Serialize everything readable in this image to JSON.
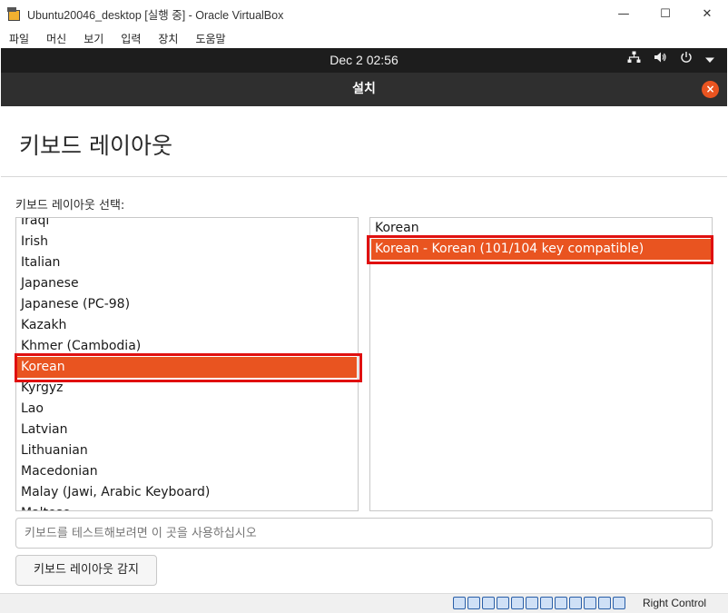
{
  "window": {
    "title": "Ubuntu20046_desktop [실행 중] - Oracle VirtualBox",
    "minimize_glyph": "—",
    "maximize_glyph": "☐",
    "close_glyph": "✕"
  },
  "menu": [
    "파일",
    "머신",
    "보기",
    "입력",
    "장치",
    "도움말"
  ],
  "panel": {
    "clock": "Dec 2  02:56",
    "icons": [
      "network-icon",
      "volume-icon",
      "power-icon",
      "chevron-down-icon"
    ]
  },
  "installer": {
    "header_title": "설치",
    "close_glyph": "×",
    "page_title": "키보드 레이아웃",
    "layout_label": "키보드 레이아웃 선택:",
    "layouts": [
      "Iraqi",
      "Irish",
      "Italian",
      "Japanese",
      "Japanese (PC-98)",
      "Kazakh",
      "Khmer (Cambodia)",
      "Korean",
      "Kyrgyz",
      "Lao",
      "Latvian",
      "Lithuanian",
      "Macedonian",
      "Malay (Jawi, Arabic Keyboard)",
      "Maltese"
    ],
    "selected_layout": "Korean",
    "variants": [
      "Korean",
      "Korean - Korean (101/104 key compatible)"
    ],
    "selected_variant": "Korean - Korean (101/104 key compatible)",
    "test_placeholder": "키보드를 테스트해보려면 이 곳을 사용하십시오",
    "detect_button": "키보드 레이아웃 감지"
  },
  "statusbar": {
    "host_key": "Right Control",
    "icons": [
      "hdd-icon",
      "optical-icon",
      "audio-icon",
      "network-icon",
      "usb-icon",
      "shared-folder-icon",
      "display-icon",
      "video-capture-icon",
      "cpu-icon",
      "mouse-icon",
      "keyboard-icon"
    ]
  },
  "colors": {
    "accent": "#e95420",
    "highlight_box": "#e01010",
    "panel_bg": "#1d1d1d",
    "header_bg": "#2f2f2f"
  }
}
